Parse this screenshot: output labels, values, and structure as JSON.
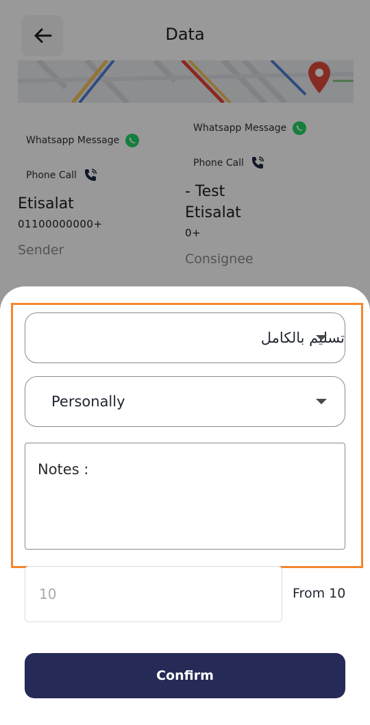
{
  "header": {
    "title": "Data"
  },
  "sender": {
    "whatsapp_label": "Whatsapp Message",
    "call_label": "Phone Call",
    "name": "Etisalat",
    "phone": "01100000000+",
    "role": "Sender"
  },
  "consignee": {
    "whatsapp_label": "Whatsapp Message",
    "call_label": "Phone Call",
    "name_line1": "- Test",
    "name_line2": "Etisalat",
    "phone": "0+",
    "role": "Consignee"
  },
  "form": {
    "status_value": "تسليم بالكامل",
    "method_value": "Personally",
    "notes_placeholder": "Notes :",
    "quantity_placeholder": "10",
    "quantity_from_label": "From 10",
    "confirm_label": "Confirm"
  },
  "colors": {
    "primary": "#262a56",
    "highlight": "#f5852b",
    "whatsapp": "#25d366"
  }
}
